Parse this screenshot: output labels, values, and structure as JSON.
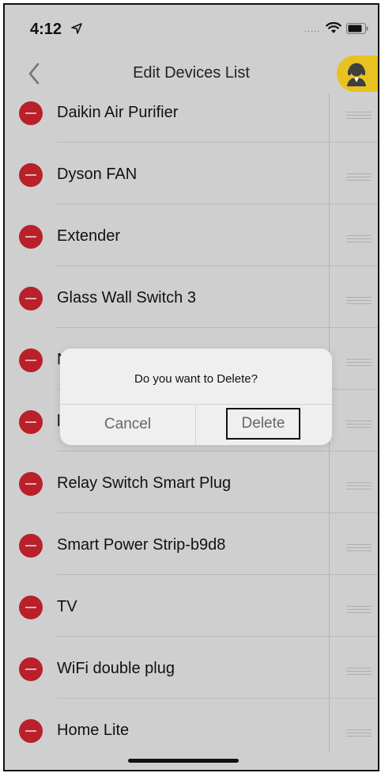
{
  "status_bar": {
    "time": "4:12",
    "signal_dots": "....."
  },
  "nav": {
    "title": "Edit Devices List",
    "back_icon": "chevron-left-icon",
    "support_icon": "customer-support-icon"
  },
  "devices": [
    {
      "name": "Daikin Air Purifier"
    },
    {
      "name": "Dyson FAN"
    },
    {
      "name": "Extender"
    },
    {
      "name": "Glass Wall Switch 3"
    },
    {
      "name": "N"
    },
    {
      "name": "l"
    },
    {
      "name": "Relay Switch Smart Plug"
    },
    {
      "name": "Smart Power Strip-b9d8"
    },
    {
      "name": "TV"
    },
    {
      "name": "WiFi double plug"
    },
    {
      "name": "Home Lite"
    }
  ],
  "dialog": {
    "message": "Do you want to Delete?",
    "cancel_label": "Cancel",
    "delete_label": "Delete"
  },
  "colors": {
    "background": "#cfcfcf",
    "delete_red": "#b9202a",
    "support_yellow": "#e8c21e"
  }
}
